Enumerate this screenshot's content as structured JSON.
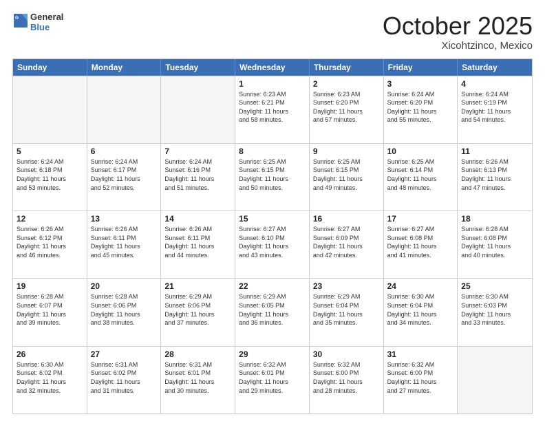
{
  "header": {
    "logo_general": "General",
    "logo_blue": "Blue",
    "month": "October 2025",
    "location": "Xicohtzinco, Mexico"
  },
  "weekdays": [
    "Sunday",
    "Monday",
    "Tuesday",
    "Wednesday",
    "Thursday",
    "Friday",
    "Saturday"
  ],
  "rows": [
    [
      {
        "day": "",
        "info": "",
        "empty": true
      },
      {
        "day": "",
        "info": "",
        "empty": true
      },
      {
        "day": "",
        "info": "",
        "empty": true
      },
      {
        "day": "1",
        "info": "Sunrise: 6:23 AM\nSunset: 6:21 PM\nDaylight: 11 hours\nand 58 minutes."
      },
      {
        "day": "2",
        "info": "Sunrise: 6:23 AM\nSunset: 6:20 PM\nDaylight: 11 hours\nand 57 minutes."
      },
      {
        "day": "3",
        "info": "Sunrise: 6:24 AM\nSunset: 6:20 PM\nDaylight: 11 hours\nand 55 minutes."
      },
      {
        "day": "4",
        "info": "Sunrise: 6:24 AM\nSunset: 6:19 PM\nDaylight: 11 hours\nand 54 minutes."
      }
    ],
    [
      {
        "day": "5",
        "info": "Sunrise: 6:24 AM\nSunset: 6:18 PM\nDaylight: 11 hours\nand 53 minutes."
      },
      {
        "day": "6",
        "info": "Sunrise: 6:24 AM\nSunset: 6:17 PM\nDaylight: 11 hours\nand 52 minutes."
      },
      {
        "day": "7",
        "info": "Sunrise: 6:24 AM\nSunset: 6:16 PM\nDaylight: 11 hours\nand 51 minutes."
      },
      {
        "day": "8",
        "info": "Sunrise: 6:25 AM\nSunset: 6:15 PM\nDaylight: 11 hours\nand 50 minutes."
      },
      {
        "day": "9",
        "info": "Sunrise: 6:25 AM\nSunset: 6:15 PM\nDaylight: 11 hours\nand 49 minutes."
      },
      {
        "day": "10",
        "info": "Sunrise: 6:25 AM\nSunset: 6:14 PM\nDaylight: 11 hours\nand 48 minutes."
      },
      {
        "day": "11",
        "info": "Sunrise: 6:26 AM\nSunset: 6:13 PM\nDaylight: 11 hours\nand 47 minutes."
      }
    ],
    [
      {
        "day": "12",
        "info": "Sunrise: 6:26 AM\nSunset: 6:12 PM\nDaylight: 11 hours\nand 46 minutes."
      },
      {
        "day": "13",
        "info": "Sunrise: 6:26 AM\nSunset: 6:11 PM\nDaylight: 11 hours\nand 45 minutes."
      },
      {
        "day": "14",
        "info": "Sunrise: 6:26 AM\nSunset: 6:11 PM\nDaylight: 11 hours\nand 44 minutes."
      },
      {
        "day": "15",
        "info": "Sunrise: 6:27 AM\nSunset: 6:10 PM\nDaylight: 11 hours\nand 43 minutes."
      },
      {
        "day": "16",
        "info": "Sunrise: 6:27 AM\nSunset: 6:09 PM\nDaylight: 11 hours\nand 42 minutes."
      },
      {
        "day": "17",
        "info": "Sunrise: 6:27 AM\nSunset: 6:08 PM\nDaylight: 11 hours\nand 41 minutes."
      },
      {
        "day": "18",
        "info": "Sunrise: 6:28 AM\nSunset: 6:08 PM\nDaylight: 11 hours\nand 40 minutes."
      }
    ],
    [
      {
        "day": "19",
        "info": "Sunrise: 6:28 AM\nSunset: 6:07 PM\nDaylight: 11 hours\nand 39 minutes."
      },
      {
        "day": "20",
        "info": "Sunrise: 6:28 AM\nSunset: 6:06 PM\nDaylight: 11 hours\nand 38 minutes."
      },
      {
        "day": "21",
        "info": "Sunrise: 6:29 AM\nSunset: 6:06 PM\nDaylight: 11 hours\nand 37 minutes."
      },
      {
        "day": "22",
        "info": "Sunrise: 6:29 AM\nSunset: 6:05 PM\nDaylight: 11 hours\nand 36 minutes."
      },
      {
        "day": "23",
        "info": "Sunrise: 6:29 AM\nSunset: 6:04 PM\nDaylight: 11 hours\nand 35 minutes."
      },
      {
        "day": "24",
        "info": "Sunrise: 6:30 AM\nSunset: 6:04 PM\nDaylight: 11 hours\nand 34 minutes."
      },
      {
        "day": "25",
        "info": "Sunrise: 6:30 AM\nSunset: 6:03 PM\nDaylight: 11 hours\nand 33 minutes."
      }
    ],
    [
      {
        "day": "26",
        "info": "Sunrise: 6:30 AM\nSunset: 6:02 PM\nDaylight: 11 hours\nand 32 minutes."
      },
      {
        "day": "27",
        "info": "Sunrise: 6:31 AM\nSunset: 6:02 PM\nDaylight: 11 hours\nand 31 minutes."
      },
      {
        "day": "28",
        "info": "Sunrise: 6:31 AM\nSunset: 6:01 PM\nDaylight: 11 hours\nand 30 minutes."
      },
      {
        "day": "29",
        "info": "Sunrise: 6:32 AM\nSunset: 6:01 PM\nDaylight: 11 hours\nand 29 minutes."
      },
      {
        "day": "30",
        "info": "Sunrise: 6:32 AM\nSunset: 6:00 PM\nDaylight: 11 hours\nand 28 minutes."
      },
      {
        "day": "31",
        "info": "Sunrise: 6:32 AM\nSunset: 6:00 PM\nDaylight: 11 hours\nand 27 minutes."
      },
      {
        "day": "",
        "info": "",
        "empty": true
      }
    ]
  ]
}
